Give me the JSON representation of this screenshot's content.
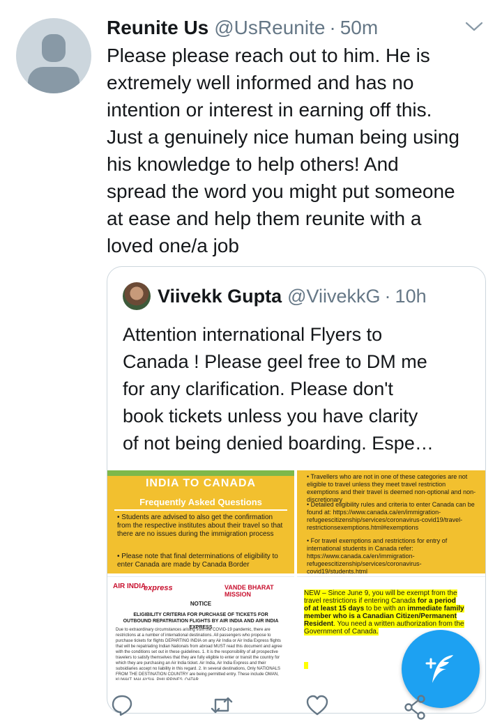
{
  "tweet": {
    "display_name": "Reunite Us",
    "handle": "@UsReunite",
    "separator": "·",
    "time": "50m",
    "text": "Please please reach out to him. He is\nextremely well informed and has no\nintention or interest in earning off this.\nJust a genuinely nice human being using\nhis knowledge to help others! And\nspread the word you might put someone\nat ease and help them reunite with a\nloved one/a job"
  },
  "quoted": {
    "display_name": "Viivekk Gupta",
    "handle": "@ViivekkG",
    "separator": "·",
    "time": "10h",
    "text": "Attention international Flyers to\nCanada ! Please geel free to DM me\nfor any clarification. Please don't\nbook tickets unless you have clarity\nof not being denied boarding. Espe…",
    "media": {
      "img1": {
        "title": "INDIA TO CANADA",
        "subtitle": "Frequently Asked Questions",
        "bullet1": "• Students are advised to also get the confirmation from the respective institutes about their travel so that there are no issues during the immigration process",
        "bullet2": "• Please note that final determinations of eligibility to enter Canada are made by Canada Border"
      },
      "img2": {
        "bullet1": "• Travellers who are not in one of these categories are not eligible to travel unless they meet travel restriction exemptions and their travel is deemed non-optional and non-discretionary",
        "bullet2": "• Detailed eligibility rules and criteria to enter Canada can be found at: https://www.canada.ca/en/immigration-refugeescitizenship/services/coronavirus-covid19/travel-restrictionsexemptions.html#exemptions",
        "bullet3": "• For travel exemptions and restrictions for entry of international students in Canada refer: https://www.canada.ca/en/immigration-refugeescitizenship/services/coronavirus-covid19/students.html"
      },
      "img3": {
        "logo": "AIR INDIA",
        "express": "express",
        "mission": "VANDE BHARAT MISSION",
        "notice": "NOTICE",
        "heading": "ELIGIBILITY CRITERIA FOR PURCHASE OF TICKETS FOR OUTBOUND REPATRIATION FLIGHTS BY AIR INDIA AND AIR INDIA EXPRESS",
        "para": "Due to extraordinary circumstances arising from the COVID-19 pandemic, there are restrictions at a number of international destinations. All passengers who propose to purchase tickets for flights DEPARTING INDIA on any Air India or Air India Express flights that will be repatriating Indian Nationals from abroad MUST read this document and agree with the conditions set out in these guidelines. 1. It is the responsibility of all prospective travelers to satisfy themselves that they are fully eligible to enter or transit the country for which they are purchasing an Air India ticket. Air India, Air India Express and their subsidiaries accept no liability in this regard. 2. In several destinations, Only NATIONALS FROM THE DESTINATION COUNTRY are being permitted entry. These include OMAN, KUWAIT, MALAYSIA, PHILIPPINES, QATAR,"
      },
      "img4": {
        "part1": "NEW – Since June 9, you will be exempt from the travel restrictions if entering Canada ",
        "part2": "for a period of at least 15 days",
        "part3": " to be with an ",
        "part4": "immediate family member who is a Canadian Citizen/Permanent Resident",
        "part5": ". You need a written authorization from the Government of Canada."
      }
    }
  },
  "actions": {
    "reply": "reply-icon",
    "retweet": "retweet-icon",
    "like": "heart-icon",
    "share": "share-icon"
  },
  "compose": "compose-tweet-icon",
  "colors": {
    "accent": "#1da1f2",
    "secondary_text": "#657786",
    "border": "#ccd6dd"
  }
}
